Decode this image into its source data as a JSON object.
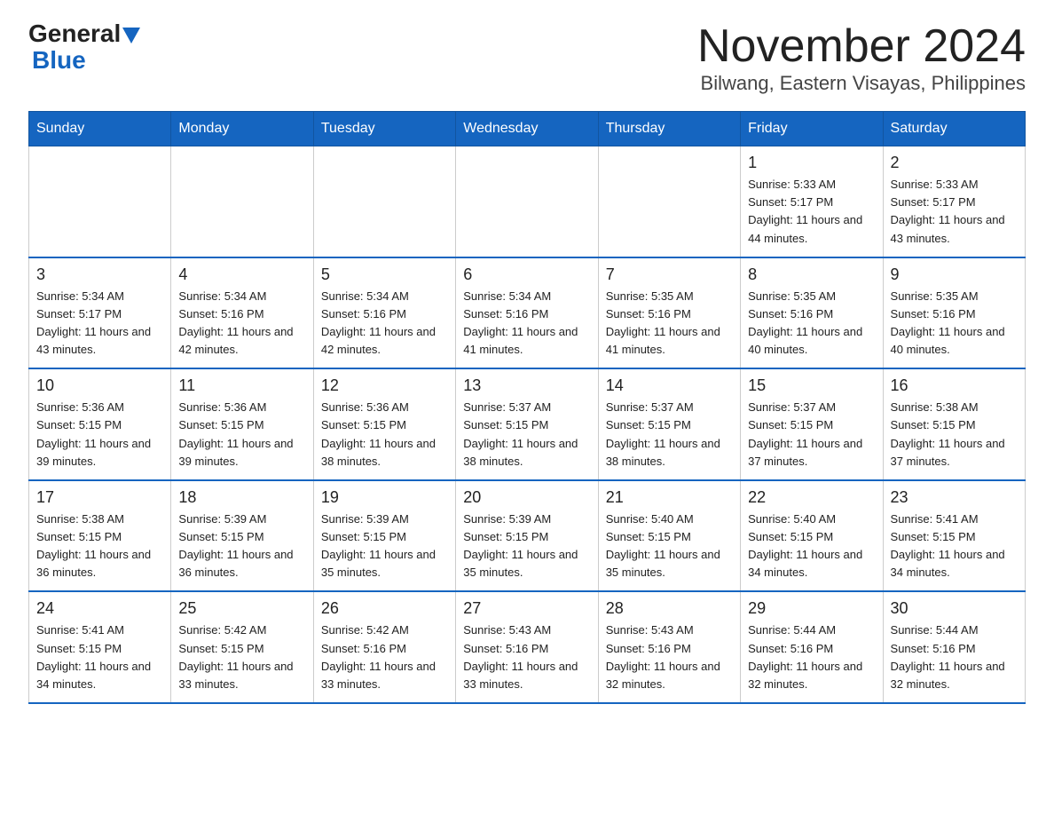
{
  "logo": {
    "general": "General",
    "blue": "Blue"
  },
  "header": {
    "title": "November 2024",
    "subtitle": "Bilwang, Eastern Visayas, Philippines"
  },
  "weekdays": [
    "Sunday",
    "Monday",
    "Tuesday",
    "Wednesday",
    "Thursday",
    "Friday",
    "Saturday"
  ],
  "weeks": [
    [
      {
        "day": "",
        "info": ""
      },
      {
        "day": "",
        "info": ""
      },
      {
        "day": "",
        "info": ""
      },
      {
        "day": "",
        "info": ""
      },
      {
        "day": "",
        "info": ""
      },
      {
        "day": "1",
        "info": "Sunrise: 5:33 AM\nSunset: 5:17 PM\nDaylight: 11 hours and 44 minutes."
      },
      {
        "day": "2",
        "info": "Sunrise: 5:33 AM\nSunset: 5:17 PM\nDaylight: 11 hours and 43 minutes."
      }
    ],
    [
      {
        "day": "3",
        "info": "Sunrise: 5:34 AM\nSunset: 5:17 PM\nDaylight: 11 hours and 43 minutes."
      },
      {
        "day": "4",
        "info": "Sunrise: 5:34 AM\nSunset: 5:16 PM\nDaylight: 11 hours and 42 minutes."
      },
      {
        "day": "5",
        "info": "Sunrise: 5:34 AM\nSunset: 5:16 PM\nDaylight: 11 hours and 42 minutes."
      },
      {
        "day": "6",
        "info": "Sunrise: 5:34 AM\nSunset: 5:16 PM\nDaylight: 11 hours and 41 minutes."
      },
      {
        "day": "7",
        "info": "Sunrise: 5:35 AM\nSunset: 5:16 PM\nDaylight: 11 hours and 41 minutes."
      },
      {
        "day": "8",
        "info": "Sunrise: 5:35 AM\nSunset: 5:16 PM\nDaylight: 11 hours and 40 minutes."
      },
      {
        "day": "9",
        "info": "Sunrise: 5:35 AM\nSunset: 5:16 PM\nDaylight: 11 hours and 40 minutes."
      }
    ],
    [
      {
        "day": "10",
        "info": "Sunrise: 5:36 AM\nSunset: 5:15 PM\nDaylight: 11 hours and 39 minutes."
      },
      {
        "day": "11",
        "info": "Sunrise: 5:36 AM\nSunset: 5:15 PM\nDaylight: 11 hours and 39 minutes."
      },
      {
        "day": "12",
        "info": "Sunrise: 5:36 AM\nSunset: 5:15 PM\nDaylight: 11 hours and 38 minutes."
      },
      {
        "day": "13",
        "info": "Sunrise: 5:37 AM\nSunset: 5:15 PM\nDaylight: 11 hours and 38 minutes."
      },
      {
        "day": "14",
        "info": "Sunrise: 5:37 AM\nSunset: 5:15 PM\nDaylight: 11 hours and 38 minutes."
      },
      {
        "day": "15",
        "info": "Sunrise: 5:37 AM\nSunset: 5:15 PM\nDaylight: 11 hours and 37 minutes."
      },
      {
        "day": "16",
        "info": "Sunrise: 5:38 AM\nSunset: 5:15 PM\nDaylight: 11 hours and 37 minutes."
      }
    ],
    [
      {
        "day": "17",
        "info": "Sunrise: 5:38 AM\nSunset: 5:15 PM\nDaylight: 11 hours and 36 minutes."
      },
      {
        "day": "18",
        "info": "Sunrise: 5:39 AM\nSunset: 5:15 PM\nDaylight: 11 hours and 36 minutes."
      },
      {
        "day": "19",
        "info": "Sunrise: 5:39 AM\nSunset: 5:15 PM\nDaylight: 11 hours and 35 minutes."
      },
      {
        "day": "20",
        "info": "Sunrise: 5:39 AM\nSunset: 5:15 PM\nDaylight: 11 hours and 35 minutes."
      },
      {
        "day": "21",
        "info": "Sunrise: 5:40 AM\nSunset: 5:15 PM\nDaylight: 11 hours and 35 minutes."
      },
      {
        "day": "22",
        "info": "Sunrise: 5:40 AM\nSunset: 5:15 PM\nDaylight: 11 hours and 34 minutes."
      },
      {
        "day": "23",
        "info": "Sunrise: 5:41 AM\nSunset: 5:15 PM\nDaylight: 11 hours and 34 minutes."
      }
    ],
    [
      {
        "day": "24",
        "info": "Sunrise: 5:41 AM\nSunset: 5:15 PM\nDaylight: 11 hours and 34 minutes."
      },
      {
        "day": "25",
        "info": "Sunrise: 5:42 AM\nSunset: 5:15 PM\nDaylight: 11 hours and 33 minutes."
      },
      {
        "day": "26",
        "info": "Sunrise: 5:42 AM\nSunset: 5:16 PM\nDaylight: 11 hours and 33 minutes."
      },
      {
        "day": "27",
        "info": "Sunrise: 5:43 AM\nSunset: 5:16 PM\nDaylight: 11 hours and 33 minutes."
      },
      {
        "day": "28",
        "info": "Sunrise: 5:43 AM\nSunset: 5:16 PM\nDaylight: 11 hours and 32 minutes."
      },
      {
        "day": "29",
        "info": "Sunrise: 5:44 AM\nSunset: 5:16 PM\nDaylight: 11 hours and 32 minutes."
      },
      {
        "day": "30",
        "info": "Sunrise: 5:44 AM\nSunset: 5:16 PM\nDaylight: 11 hours and 32 minutes."
      }
    ]
  ]
}
